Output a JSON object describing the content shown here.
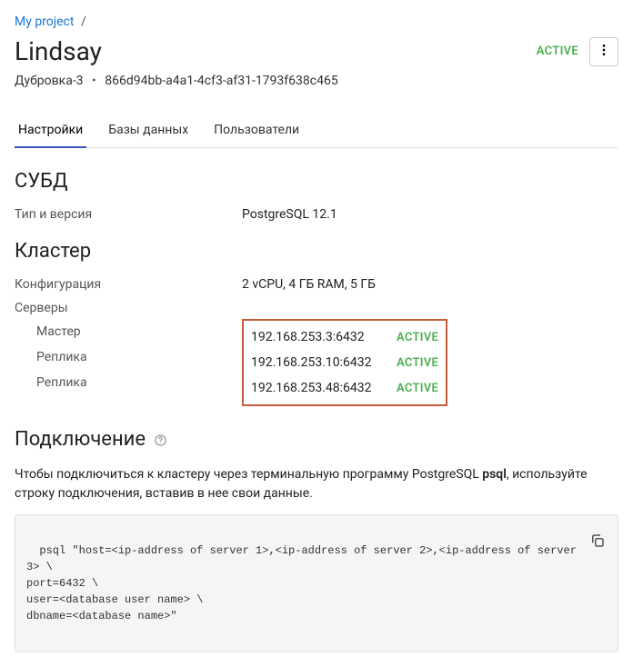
{
  "breadcrumb": {
    "project": "My project"
  },
  "header": {
    "title": "Lindsay",
    "status": "ACTIVE"
  },
  "subline": {
    "zone": "Дубровка-3",
    "uuid": "866d94bb-a4a1-4cf3-af31-1793f638c465"
  },
  "tabs": {
    "settings": "Настройки",
    "databases": "Базы данных",
    "users": "Пользователи"
  },
  "sections": {
    "dbms": {
      "heading": "СУБД",
      "type_label": "Тип и версия",
      "type_value": "PostgreSQL 12.1"
    },
    "cluster": {
      "heading": "Кластер",
      "config_label": "Конфигурация",
      "config_value": "2 vCPU, 4 ГБ RAM, 5 ГБ",
      "servers_label": "Серверы",
      "servers": [
        {
          "role": "Мастер",
          "addr": "192.168.253.3:6432",
          "status": "ACTIVE"
        },
        {
          "role": "Реплика",
          "addr": "192.168.253.10:6432",
          "status": "ACTIVE"
        },
        {
          "role": "Реплика",
          "addr": "192.168.253.48:6432",
          "status": "ACTIVE"
        }
      ]
    },
    "connection": {
      "heading": "Подключение",
      "text_prefix": "Чтобы подключиться к кластеру через терминальную программу PostgreSQL ",
      "tool": "psql",
      "text_suffix": ", используйте строку подключения, вставив в нее свои данные.",
      "code": "psql \"host=<ip-address of server 1>,<ip-address of server 2>,<ip-address of server 3> \\\nport=6432 \\\nuser=<database user name> \\\ndbname=<database name>\""
    }
  }
}
